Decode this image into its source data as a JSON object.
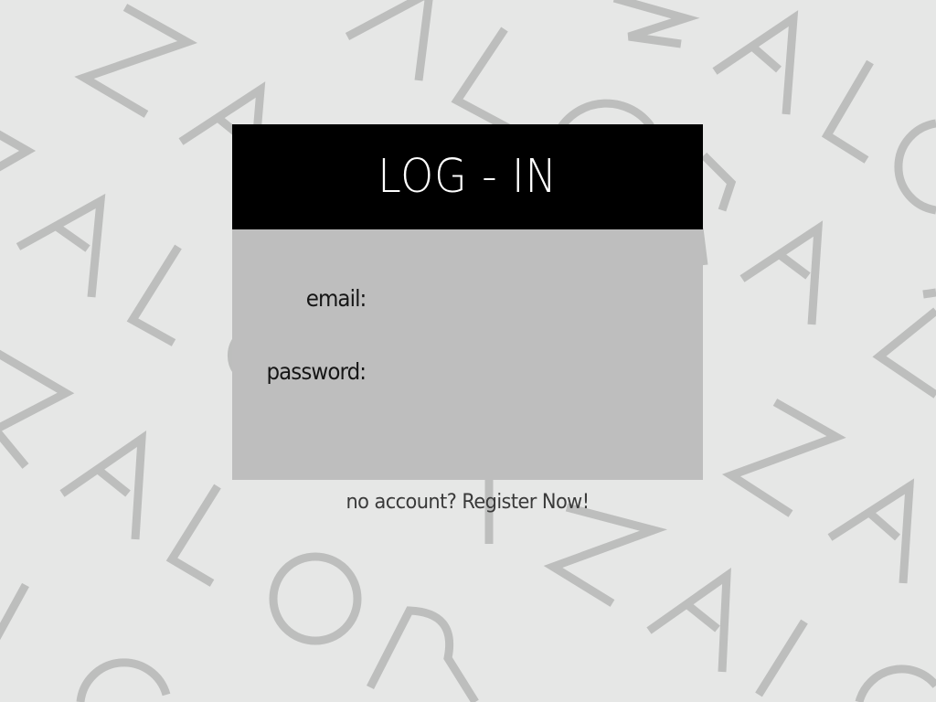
{
  "login": {
    "title": "LOG - IN",
    "email_label": "email:",
    "email_value": "",
    "password_label": "password:",
    "password_value": ""
  },
  "register_link": "no account? Register Now!",
  "background": {
    "decoration": "background-letter-pattern"
  },
  "colors": {
    "page_background": "#e6e7e6",
    "pattern_letters": "#bdbebd",
    "header_background": "#000000",
    "header_text": "#ffffff",
    "form_background": "#bebebe",
    "label_text": "#161616",
    "link_text": "#3a3a3a"
  }
}
